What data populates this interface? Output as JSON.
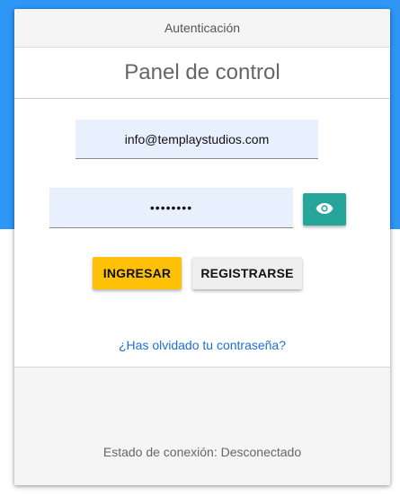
{
  "header": {
    "title": "Autenticación"
  },
  "panel": {
    "title": "Panel de control"
  },
  "form": {
    "email_value": "info@templaystudios.com",
    "password_value": "••••••••",
    "show_password_icon": "eye-icon",
    "login_label": "INGRESAR",
    "register_label": "REGISTRARSE",
    "forgot_link": "¿Has olvidado tu contraseña?"
  },
  "footer": {
    "status": "Estado de conexión: Desconectado"
  },
  "colors": {
    "background_accent": "#2e96f5",
    "login_button": "#ffc107",
    "register_button": "#eeeeee",
    "eye_button": "#26a69a",
    "link": "#1e6fd0",
    "input_fill": "#e8f0fe"
  }
}
